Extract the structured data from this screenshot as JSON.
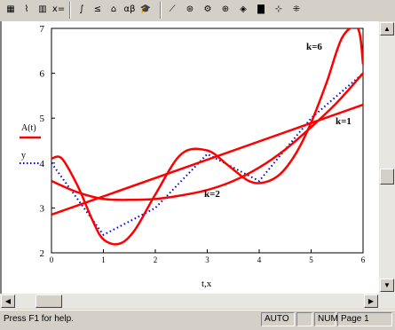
{
  "toolbar": {
    "buttons": [
      {
        "name": "calculator-toolbar-icon",
        "glyph": "▦"
      },
      {
        "name": "graph-toolbar-icon",
        "glyph": "⌇"
      },
      {
        "name": "matrix-toolbar-icon",
        "glyph": "▥"
      },
      {
        "name": "evaluation-toolbar-icon",
        "glyph": "x="
      },
      {
        "name": "calculus-toolbar-icon",
        "glyph": "∫"
      },
      {
        "name": "boolean-toolbar-icon",
        "glyph": "≤"
      },
      {
        "name": "programming-toolbar-icon",
        "glyph": "⌂"
      },
      {
        "name": "greek-toolbar-icon",
        "glyph": "αβ"
      },
      {
        "name": "symbolic-toolbar-icon",
        "glyph": "🎓"
      },
      {
        "name": "xy-plot-icon",
        "glyph": "⟋"
      },
      {
        "name": "polar-plot-icon",
        "glyph": "⊛"
      },
      {
        "name": "surface-plot-icon",
        "glyph": "⚙"
      },
      {
        "name": "contour-plot-icon",
        "glyph": "⊕"
      },
      {
        "name": "3d-scatter-icon",
        "glyph": "◈"
      },
      {
        "name": "3d-bar-icon",
        "glyph": "▇"
      },
      {
        "name": "vector-field-icon",
        "glyph": "⊹"
      },
      {
        "name": "plot-wizard-icon",
        "glyph": "⁜"
      }
    ]
  },
  "plot": {
    "legend": {
      "series1": "A(t)",
      "series2": "y"
    },
    "x_axis_label": "t,x",
    "curve_labels": {
      "k6": "k=6",
      "k1": "k=1",
      "k2": "k=2"
    },
    "colors": {
      "curve": "#ff0000",
      "data": "#0000cc"
    }
  },
  "chart_data": {
    "type": "line",
    "xlim": [
      0,
      6
    ],
    "ylim": [
      2,
      7
    ],
    "x_ticks": [
      "0",
      "1",
      "2",
      "3",
      "4",
      "5",
      "6"
    ],
    "y_ticks": [
      "2",
      "3",
      "4",
      "5",
      "6",
      "7"
    ],
    "xlabel": "t,x",
    "data_points": {
      "x": [
        0,
        1,
        2,
        3,
        4,
        5,
        6
      ],
      "y": [
        4.0,
        2.4,
        3.0,
        4.2,
        3.6,
        5.0,
        6.0
      ]
    },
    "series": [
      {
        "name": "k=1",
        "x": [
          0,
          6
        ],
        "y": [
          2.85,
          5.3
        ]
      },
      {
        "name": "k=2",
        "x": [
          0,
          0.5,
          1,
          1.5,
          2,
          2.5,
          3,
          3.5,
          4,
          4.5,
          5,
          5.5,
          6
        ],
        "y": [
          3.6,
          3.35,
          3.2,
          3.18,
          3.2,
          3.28,
          3.4,
          3.6,
          3.9,
          4.3,
          4.8,
          5.35,
          6.0
        ]
      },
      {
        "name": "k=6",
        "x": [
          0,
          0.2,
          0.5,
          0.8,
          1.0,
          1.3,
          1.6,
          2.0,
          2.5,
          3.0,
          3.4,
          3.8,
          4.1,
          4.4,
          4.7,
          5.0,
          5.3,
          5.6,
          5.9,
          6.0
        ],
        "y": [
          4.1,
          4.1,
          3.5,
          2.7,
          2.3,
          2.2,
          2.5,
          3.3,
          4.2,
          4.28,
          3.95,
          3.6,
          3.57,
          3.75,
          4.2,
          4.9,
          5.8,
          6.8,
          7.0,
          6.2
        ]
      }
    ]
  },
  "status": {
    "help_text": "Press F1 for help.",
    "panes": [
      "AUTO",
      "",
      "NUM",
      "Page 1"
    ]
  }
}
